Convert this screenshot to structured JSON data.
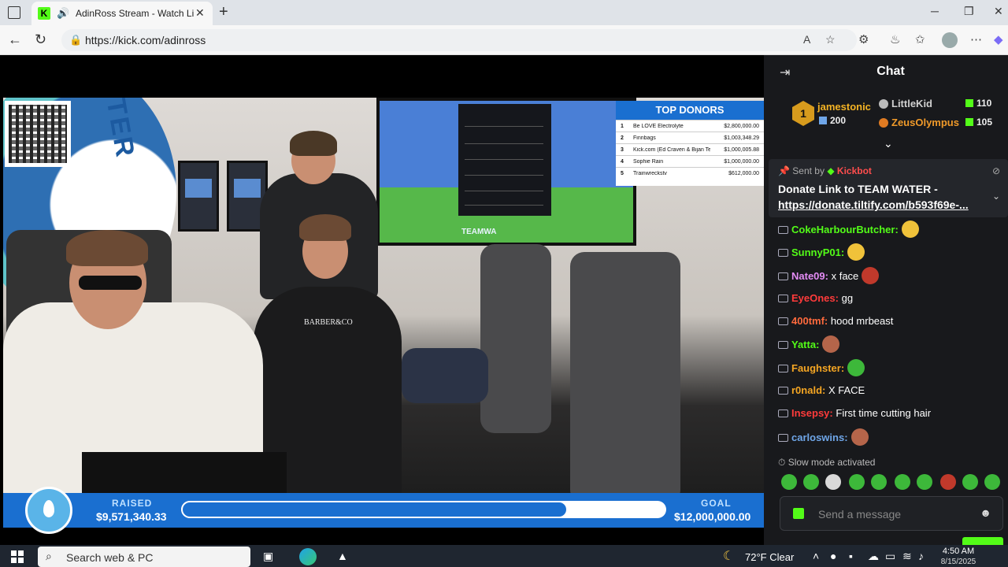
{
  "browser": {
    "tab_title": "AdinRoss Stream - Watch Li",
    "url": "https://kick.com/adinross"
  },
  "stream": {
    "top_donors_title": "TOP DONORS",
    "donors": [
      {
        "rank": "1",
        "name": "Be LOVE Electrolyte",
        "amount": "$2,800,000.00"
      },
      {
        "rank": "2",
        "name": "Finnbags",
        "amount": "$1,003,348.29"
      },
      {
        "rank": "3",
        "name": "Kick.com (Ed Craven & Bijan Te...",
        "amount": "$1,000,005.88"
      },
      {
        "rank": "4",
        "name": "Sophie Rain",
        "amount": "$1,000,000.00"
      },
      {
        "rank": "5",
        "name": "Trainwreckstv",
        "amount": "$612,000.00"
      }
    ],
    "wall_text": "TER",
    "tv_label": "TEAMWA",
    "cape_brand": "BARBER&CO",
    "raised_label": "RAISED",
    "raised_value": "$9,571,340.33",
    "goal_label": "GOAL",
    "goal_value": "$12,000,000.00",
    "progress_fraction": 0.7976
  },
  "chat": {
    "title": "Chat",
    "leaderboard": {
      "first": {
        "rank": "1",
        "name": "jamestonic",
        "value": "200",
        "color": "#f4b324"
      },
      "second": {
        "name": "LittleKid",
        "value": "110",
        "color": "#d0d0d0"
      },
      "third": {
        "name": "ZeusOlympus",
        "value": "105",
        "color": "#f09a2a"
      }
    },
    "pinned": {
      "sent_by_label": "Sent by",
      "sender": "Kickbot",
      "line1": "Donate Link to TEAM WATER -",
      "line2": "https://donate.tiltify.com/b593f69e-..."
    },
    "messages": [
      {
        "user": "CokeHarbourButcher:",
        "text": "",
        "color": "#53fc18",
        "emote": "#f0c23a"
      },
      {
        "user": "SunnyP01:",
        "text": "",
        "color": "#53fc18",
        "emote": "#f0c23a"
      },
      {
        "user": "Nate09:",
        "text": "x face",
        "color": "#e38cf4",
        "emote": "#c0392b"
      },
      {
        "user": "EyeOnes:",
        "text": "gg",
        "color": "#ff3b3b",
        "emote": ""
      },
      {
        "user": "400tmf:",
        "text": "hood mrbeast",
        "color": "#ff6a3d",
        "emote": ""
      },
      {
        "user": "Yatta:",
        "text": "",
        "color": "#53fc18",
        "emote": "#b5654a"
      },
      {
        "user": "Faughster:",
        "text": "",
        "color": "#f5a623",
        "emote": "#3db83a"
      },
      {
        "user": "r0nald:",
        "text": "X FACE",
        "color": "#f5a623",
        "emote": ""
      },
      {
        "user": "Insepsy:",
        "text": "First time cutting hair",
        "color": "#ff3b3b",
        "emote": ""
      },
      {
        "user": "carloswins:",
        "text": "",
        "color": "#6fa6e8",
        "emote": "#b5654a"
      }
    ],
    "slow_mode": "Slow mode activated",
    "input_placeholder": "Send a message"
  },
  "taskbar": {
    "search_text": "Search web & PC",
    "weather": "72°F  Clear",
    "time": "4:50 AM",
    "date": "8/15/2025"
  }
}
